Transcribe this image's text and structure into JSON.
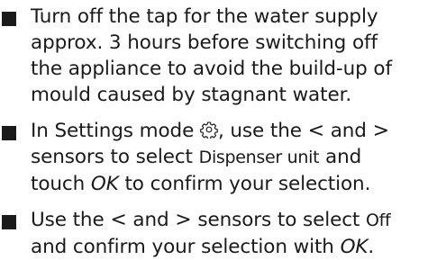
{
  "steps": [
    {
      "lines": [
        "Turn off the tap for the water supply",
        "approx. 3 hours before switching off",
        "the appliance to avoid the build-up of",
        "mould caused by stagnant water."
      ]
    },
    {
      "line1_before_icon": "In Settings mode ",
      "line1_after_icon": ", use the ",
      "lt": "<",
      "and": " and ",
      "gt": ">",
      "line2_before": "sensors to select ",
      "line2_ui": "Dispenser unit",
      "line2_after": " and",
      "line3_touch": "touch ",
      "line3_ok": "OK",
      "line3_after": " to confirm your selection."
    },
    {
      "line1_before": "Use the ",
      "lt": "<",
      "and": " and ",
      "gt": ">",
      "line1_mid": " sensors to select ",
      "line1_ui": "Off",
      "line2_before": "and confirm your selection with ",
      "line2_ok": "OK",
      "line2_after": "."
    }
  ],
  "icons": {
    "bullet": "square-bullet-icon",
    "settings": "gear-icon"
  }
}
